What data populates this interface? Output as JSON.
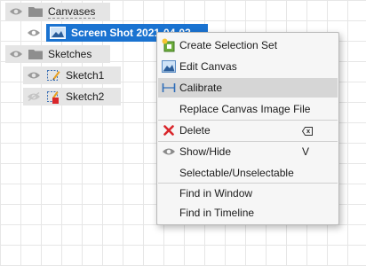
{
  "browser": {
    "canvases": {
      "label": "Canvases"
    },
    "canvas_item": {
      "label": "Screen Shot 2021-04-03 ..."
    },
    "sketches": {
      "label": "Sketches"
    },
    "sketch1": {
      "label": "Sketch1"
    },
    "sketch2": {
      "label": "Sketch2"
    }
  },
  "context_menu": {
    "items": [
      {
        "label": "Create Selection Set",
        "icon": "create-selection-set-icon"
      },
      {
        "label": "Edit Canvas",
        "icon": "edit-canvas-icon"
      },
      {
        "label": "Calibrate",
        "icon": "calibrate-icon",
        "highlighted": true
      },
      {
        "label": "Replace Canvas Image File"
      },
      {
        "label": "Delete",
        "icon": "delete-icon",
        "shortcut_icon": "delete-key-icon"
      },
      {
        "label": "Show/Hide",
        "icon": "eye-icon",
        "shortcut": "V"
      },
      {
        "label": "Selectable/Unselectable"
      },
      {
        "label": "Find in Window"
      },
      {
        "label": "Find in Timeline"
      }
    ]
  },
  "colors": {
    "selection": "#1a73d1",
    "highlight": "#d6d6d6",
    "delete": "#d9262b"
  }
}
